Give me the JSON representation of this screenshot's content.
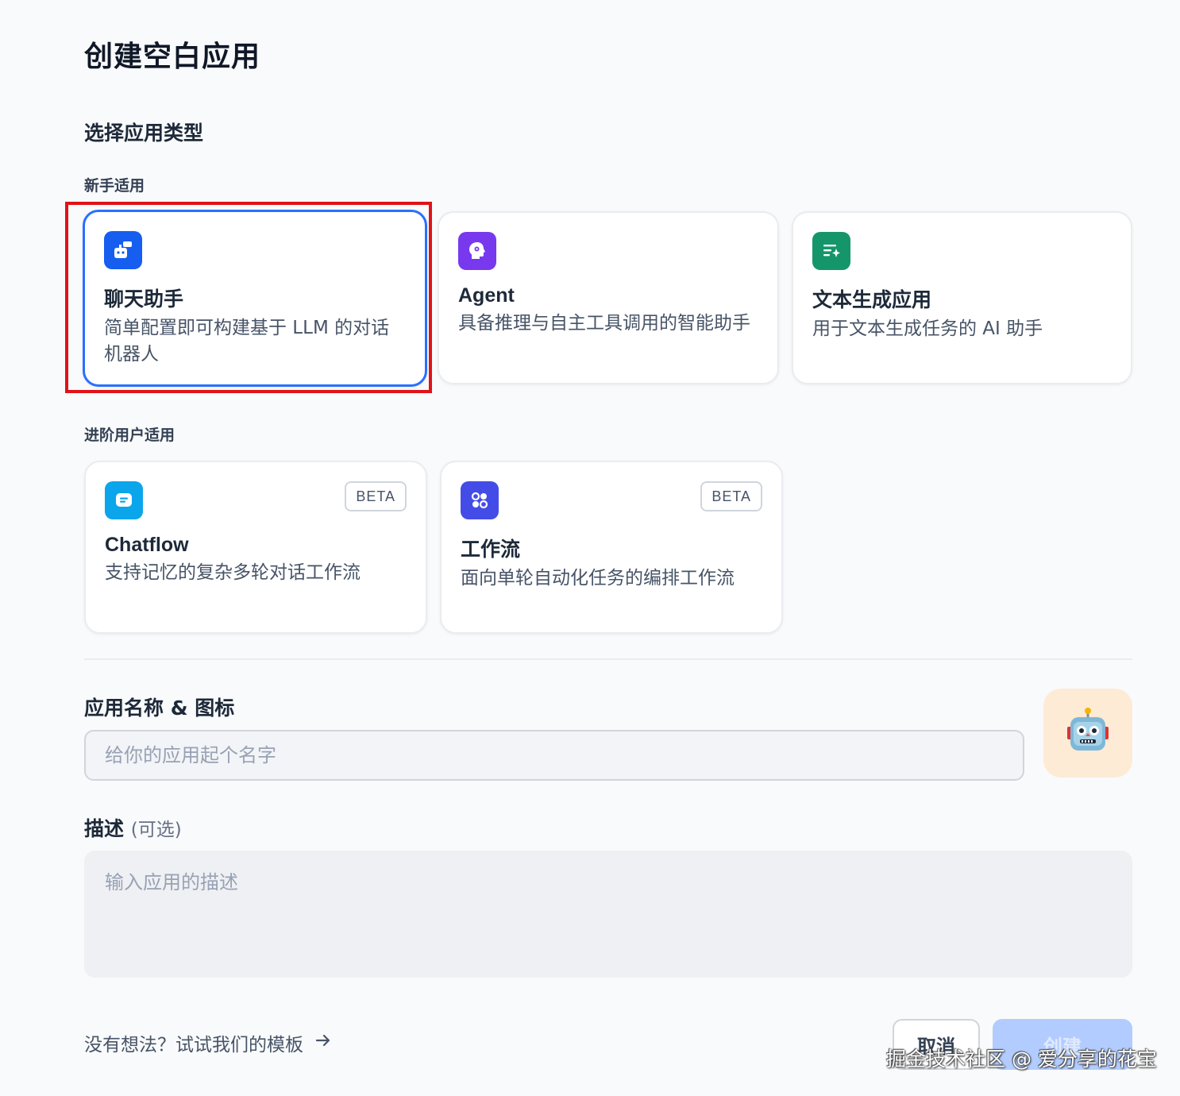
{
  "page_title": "创建空白应用",
  "section_title": "选择应用类型",
  "groups": {
    "beginner": "新手适用",
    "advanced": "进阶用户适用"
  },
  "cards": {
    "chat": {
      "title": "聊天助手",
      "desc": "简单配置即可构建基于 LLM 的对话机器人",
      "icon": "chat-bot-icon",
      "color": "#155eef",
      "selected": true
    },
    "agent": {
      "title": "Agent",
      "desc": "具备推理与自主工具调用的智能助手",
      "icon": "agent-brain-icon",
      "color": "#7839ee"
    },
    "textgen": {
      "title": "文本生成应用",
      "desc": "用于文本生成任务的 AI 助手",
      "icon": "text-sparkle-icon",
      "color": "#15966a"
    },
    "chatflow": {
      "title": "Chatflow",
      "desc": "支持记忆的复杂多轮对话工作流",
      "badge": "BETA",
      "icon": "chatflow-icon",
      "color": "#0ba5ec"
    },
    "workflow": {
      "title": "工作流",
      "desc": "面向单轮自动化任务的编排工作流",
      "badge": "BETA",
      "icon": "workflow-icon",
      "color": "#444ce7"
    }
  },
  "form": {
    "name_label": "应用名称 & 图标",
    "name_placeholder": "给你的应用起个名字",
    "avatar_icon": "robot-icon",
    "desc_label": "描述",
    "desc_optional": "(可选)",
    "desc_placeholder": "输入应用的描述"
  },
  "footer": {
    "template_link": "没有想法？试试我们的模板",
    "cancel": "取消",
    "create": "创建"
  },
  "watermark": "掘金技术社区 @ 爱分享的花宝"
}
